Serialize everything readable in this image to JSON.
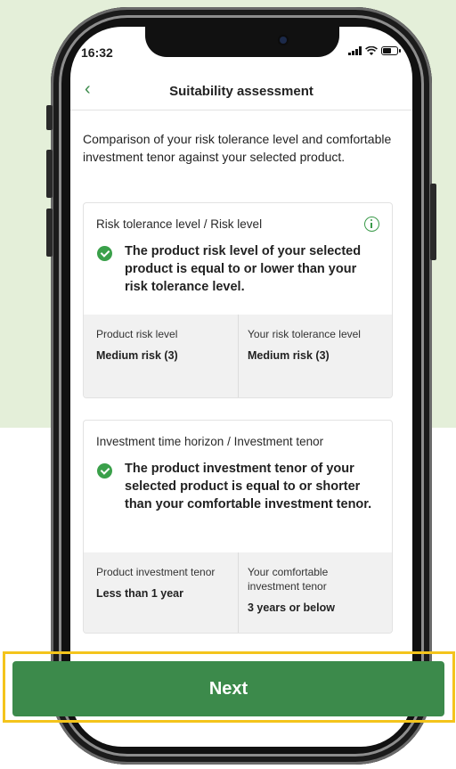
{
  "status_bar": {
    "time": "16:32"
  },
  "header": {
    "title": "Suitability assessment"
  },
  "intro": "Comparison of your risk tolerance level and comfortable investment tenor against your selected product.",
  "risk_card": {
    "heading": "Risk tolerance level / Risk level",
    "statement": "The product risk level of your selected product is equal to or lower than your risk tolerance level.",
    "product_label": "Product risk level",
    "product_value": "Medium risk (3)",
    "user_label": "Your risk tolerance level",
    "user_value": "Medium risk (3)"
  },
  "tenor_card": {
    "heading": "Investment time horizon / Investment tenor",
    "statement": "The product investment tenor of your selected product is equal to or shorter than your comfortable investment tenor.",
    "product_label": "Product investment tenor",
    "product_value": "Less than 1 year",
    "user_label": "Your comfortable investment tenor",
    "user_value": "3 years or below"
  },
  "next_button": {
    "label": "Next"
  },
  "icons": {
    "back": "chevron-left-icon",
    "info": "info-icon",
    "check": "check-circle-icon"
  },
  "colors": {
    "accent": "#3c8a4b",
    "background": "#e4efd9",
    "highlight": "#f4c41c"
  }
}
